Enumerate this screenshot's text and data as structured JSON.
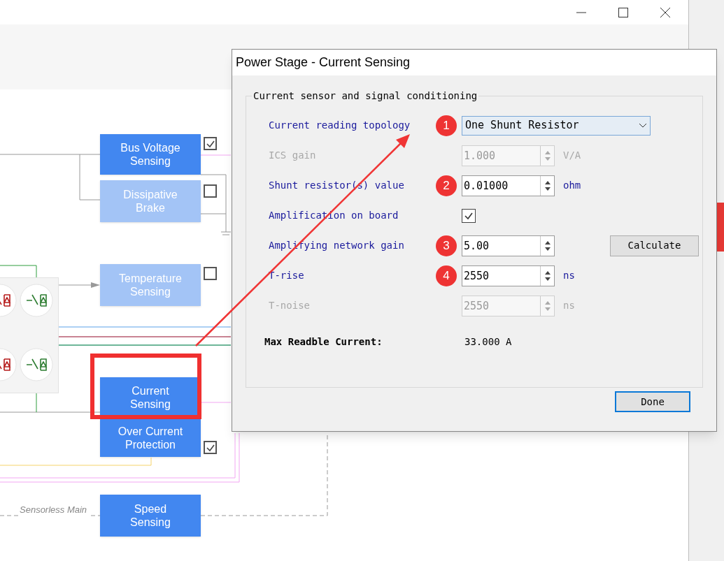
{
  "diagram": {
    "blocks": [
      {
        "label": "Bus Voltage Sensing",
        "enabled": true,
        "checked": true
      },
      {
        "label": "Dissipative Brake",
        "enabled": false,
        "checked": false
      },
      {
        "label": "Temperature Sensing",
        "enabled": false,
        "checked": false
      },
      {
        "label": "Current Sensing",
        "enabled": true,
        "highlighted": true
      },
      {
        "label": "Over Current Protection",
        "enabled": true,
        "checked": true
      },
      {
        "label": "Speed Sensing",
        "enabled": true
      }
    ],
    "region_label": "Sensorless Main"
  },
  "dialog": {
    "title": "Power Stage - Current Sensing",
    "group_title": "Current sensor and signal conditioning",
    "rows": [
      {
        "kind": "dropdown",
        "label": "Current reading topology",
        "badge": "1",
        "value": "One Shunt Resistor",
        "disabled": false
      },
      {
        "kind": "spin",
        "label": "ICS gain",
        "value": "1.000",
        "unit": "V/A",
        "disabled": true
      },
      {
        "kind": "spin",
        "label": "Shunt resistor(s) value",
        "badge": "2",
        "value": "0.01000",
        "unit": "ohm",
        "disabled": false
      },
      {
        "kind": "checkbox",
        "label": "Amplification on board",
        "checked": true,
        "disabled": false
      },
      {
        "kind": "spin",
        "label": "Amplifying network gain",
        "badge": "3",
        "value": "5.00",
        "button": "Calculate",
        "disabled": false
      },
      {
        "kind": "spin",
        "label": "T-rise",
        "badge": "4",
        "value": "2550",
        "unit": "ns",
        "disabled": false
      },
      {
        "kind": "spin",
        "label": "T-noise",
        "value": "2550",
        "unit": "ns",
        "disabled": true
      }
    ],
    "result_label": "Max Readble Current:",
    "result_value": "33.000 A",
    "done_button": "Done"
  }
}
